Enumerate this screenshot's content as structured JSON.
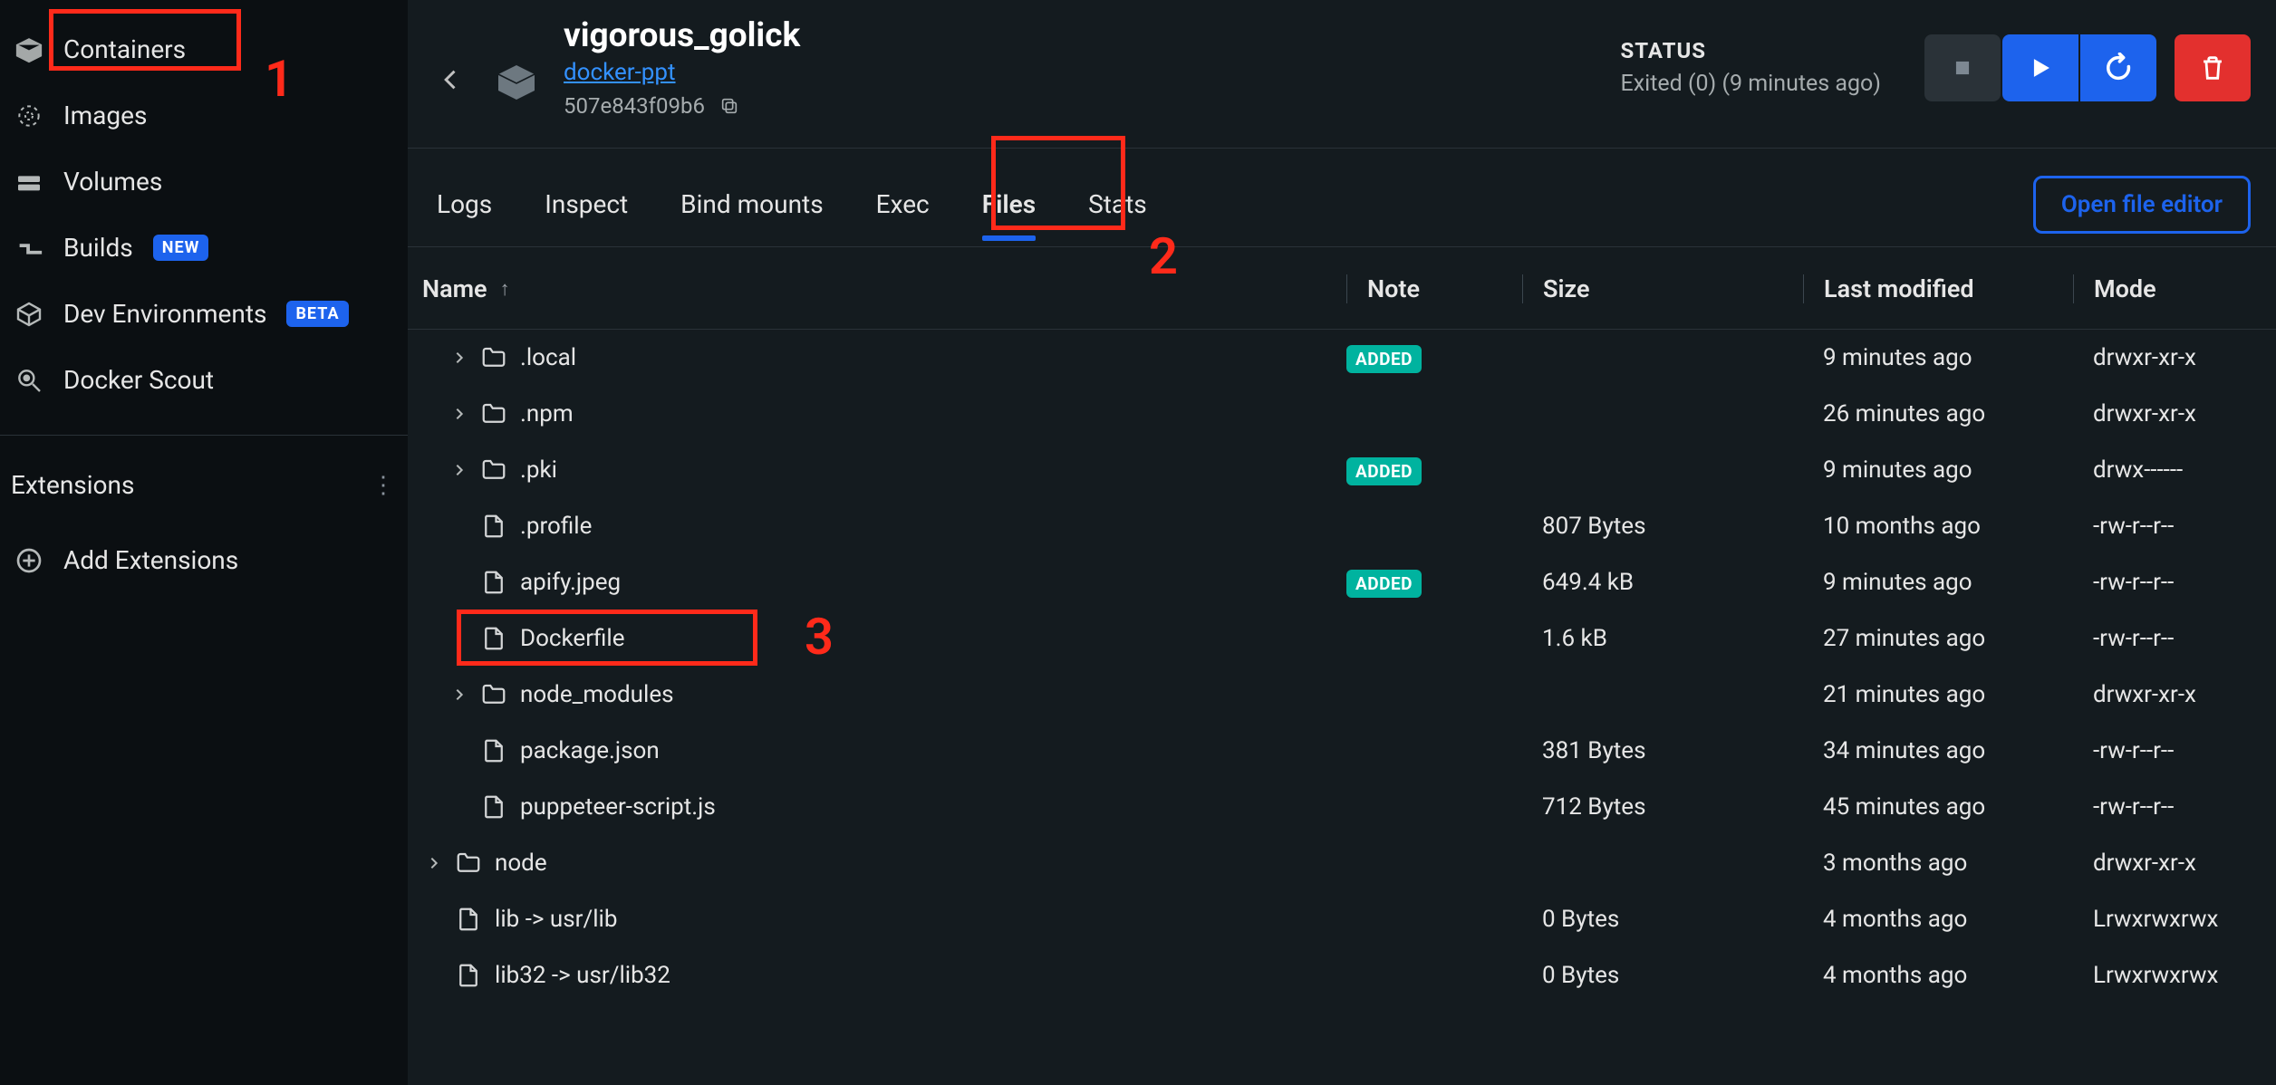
{
  "sidebar": {
    "items": [
      {
        "label": "Containers"
      },
      {
        "label": "Images"
      },
      {
        "label": "Volumes"
      },
      {
        "label": "Builds",
        "badge": "NEW"
      },
      {
        "label": "Dev Environments",
        "badge": "BETA"
      },
      {
        "label": "Docker Scout"
      }
    ],
    "extensions_label": "Extensions",
    "add_extensions_label": "Add Extensions"
  },
  "header": {
    "title": "vigorous_golick",
    "image_link": "docker-ppt",
    "container_id": "507e843f09b6",
    "status_label": "STATUS",
    "status_text": "Exited (0) (9 minutes ago)"
  },
  "tabs": {
    "items": [
      "Logs",
      "Inspect",
      "Bind mounts",
      "Exec",
      "Files",
      "Stats"
    ],
    "active": "Files",
    "open_editor": "Open file editor"
  },
  "table": {
    "columns": {
      "name": "Name",
      "note": "Note",
      "size": "Size",
      "mod": "Last modified",
      "mode": "Mode"
    }
  },
  "files": [
    {
      "name": ".local",
      "type": "folder",
      "expandable": true,
      "indent": 1,
      "note": "ADDED",
      "size": "",
      "mod": "9 minutes ago",
      "mode": "drwxr-xr-x"
    },
    {
      "name": ".npm",
      "type": "folder",
      "expandable": true,
      "indent": 1,
      "note": "",
      "size": "",
      "mod": "26 minutes ago",
      "mode": "drwxr-xr-x"
    },
    {
      "name": ".pki",
      "type": "folder",
      "expandable": true,
      "indent": 1,
      "note": "ADDED",
      "size": "",
      "mod": "9 minutes ago",
      "mode": "drwx------"
    },
    {
      "name": ".profile",
      "type": "file",
      "expandable": false,
      "indent": 1,
      "note": "",
      "size": "807 Bytes",
      "mod": "10 months ago",
      "mode": "-rw-r--r--"
    },
    {
      "name": "apify.jpeg",
      "type": "file",
      "expandable": false,
      "indent": 1,
      "note": "ADDED",
      "size": "649.4 kB",
      "mod": "9 minutes ago",
      "mode": "-rw-r--r--"
    },
    {
      "name": "Dockerfile",
      "type": "file",
      "expandable": false,
      "indent": 1,
      "note": "",
      "size": "1.6 kB",
      "mod": "27 minutes ago",
      "mode": "-rw-r--r--"
    },
    {
      "name": "node_modules",
      "type": "folder",
      "expandable": true,
      "indent": 1,
      "note": "",
      "size": "",
      "mod": "21 minutes ago",
      "mode": "drwxr-xr-x"
    },
    {
      "name": "package.json",
      "type": "file",
      "expandable": false,
      "indent": 1,
      "note": "",
      "size": "381 Bytes",
      "mod": "34 minutes ago",
      "mode": "-rw-r--r--"
    },
    {
      "name": "puppeteer-script.js",
      "type": "file",
      "expandable": false,
      "indent": 1,
      "note": "",
      "size": "712 Bytes",
      "mod": "45 minutes ago",
      "mode": "-rw-r--r--"
    },
    {
      "name": "node",
      "type": "folder",
      "expandable": true,
      "indent": 0,
      "note": "",
      "size": "",
      "mod": "3 months ago",
      "mode": "drwxr-xr-x"
    },
    {
      "name": "lib -> usr/lib",
      "type": "file",
      "expandable": false,
      "indent": 0,
      "note": "",
      "size": "0 Bytes",
      "mod": "4 months ago",
      "mode": "Lrwxrwxrwx"
    },
    {
      "name": "lib32 -> usr/lib32",
      "type": "file",
      "expandable": false,
      "indent": 0,
      "note": "",
      "size": "0 Bytes",
      "mod": "4 months ago",
      "mode": "Lrwxrwxrwx"
    }
  ],
  "annotations": {
    "n1": "1",
    "n2": "2",
    "n3": "3"
  }
}
